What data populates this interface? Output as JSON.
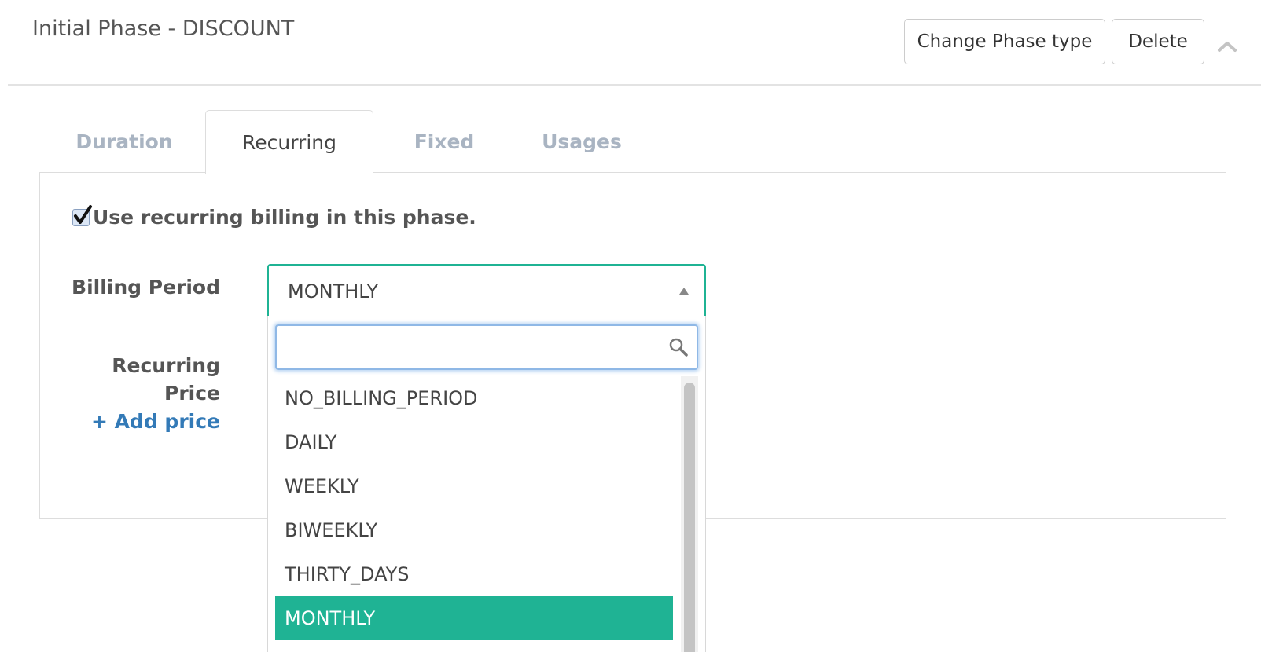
{
  "header": {
    "title": "Initial Phase - DISCOUNT",
    "change_phase_type_label": "Change Phase type",
    "delete_label": "Delete",
    "collapse_icon": "chevron-up-icon"
  },
  "tabs": [
    {
      "label": "Duration",
      "active": false
    },
    {
      "label": "Recurring",
      "active": true
    },
    {
      "label": "Fixed",
      "active": false
    },
    {
      "label": "Usages",
      "active": false
    }
  ],
  "recurring": {
    "use_recurring_label": "Use recurring billing in this phase.",
    "use_recurring_checked": true,
    "billing_period_label": "Billing Period",
    "billing_period_value": "MONTHLY",
    "recurring_price_label_line1": "Recurring",
    "recurring_price_label_line2": "Price",
    "add_price_label": "+ Add price"
  },
  "dropdown": {
    "search_value": "",
    "search_icon": "search-icon",
    "options": [
      "NO_BILLING_PERIOD",
      "DAILY",
      "WEEKLY",
      "BIWEEKLY",
      "THIRTY_DAYS",
      "MONTHLY"
    ],
    "selected": "MONTHLY"
  },
  "colors": {
    "accent": "#1fb394",
    "link": "#337ab7",
    "inactive_tab": "#a9b4c2"
  }
}
